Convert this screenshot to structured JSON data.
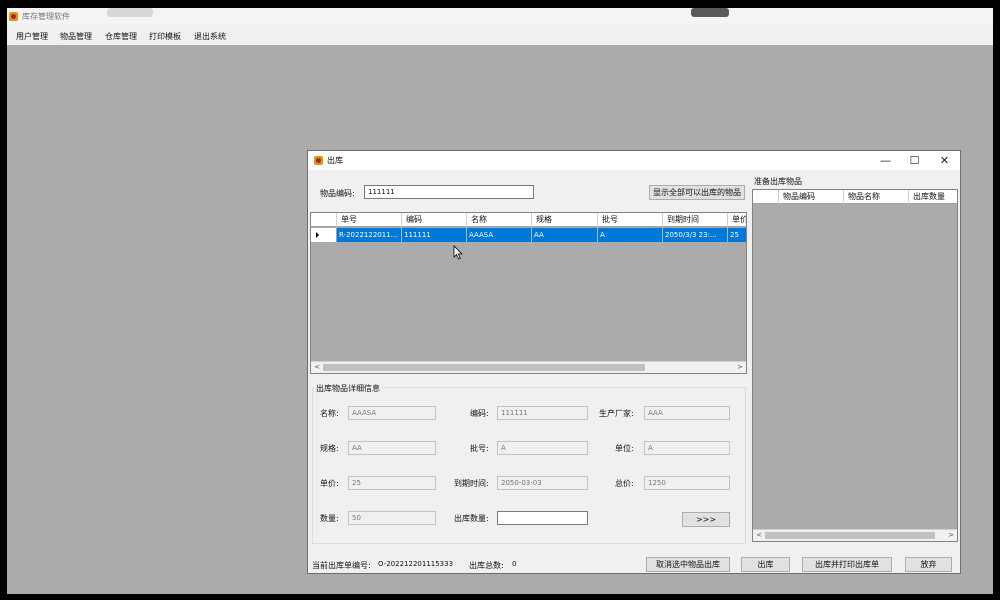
{
  "app": {
    "title": "库存管理软件"
  },
  "menu": {
    "items": [
      "用户管理",
      "物品管理",
      "仓库管理",
      "打印模板",
      "退出系统"
    ]
  },
  "dialog": {
    "title": "出库",
    "controls": {
      "minimize": "—",
      "maximize": "☐",
      "close": "✕"
    },
    "search": {
      "label": "物品编码:",
      "value": "111111"
    },
    "show_all_button": "显示全部可以出库的物品",
    "available_grid": {
      "columns": [
        "单号",
        "编码",
        "名称",
        "规格",
        "批号",
        "到期时间",
        "单价"
      ],
      "rows": [
        [
          "R-2022122011...",
          "111111",
          "AAASA",
          "AA",
          "A",
          "2050/3/3 23:...",
          "25"
        ]
      ]
    },
    "ready_title": "准备出库物品",
    "ready_grid": {
      "columns": [
        "物品编码",
        "物品名称",
        "出库数量"
      ]
    },
    "details": {
      "title": "出库物品详细信息",
      "fields": {
        "name": {
          "label": "名称:",
          "value": "AAASA"
        },
        "code": {
          "label": "编码:",
          "value": "111111"
        },
        "maker": {
          "label": "生产厂家:",
          "value": "AAA"
        },
        "spec": {
          "label": "规格:",
          "value": "AA"
        },
        "batch": {
          "label": "批号:",
          "value": "A"
        },
        "unit": {
          "label": "单位:",
          "value": "A"
        },
        "price": {
          "label": "单价:",
          "value": "25"
        },
        "expiry": {
          "label": "到期时间:",
          "value": "2050-03-03"
        },
        "total": {
          "label": "总价:",
          "value": "1250"
        },
        "qty": {
          "label": "数量:",
          "value": "50"
        },
        "out_qty": {
          "label": "出库数量:",
          "value": ""
        }
      },
      "add_button": ">>>"
    },
    "footer": {
      "order_label": "当前出库单编号:",
      "order_value": "O-202212201115333",
      "total_label": "出库总数:",
      "total_value": "0"
    },
    "buttons": {
      "cancel_selected": "取消选中物品出库",
      "out": "出库",
      "out_print": "出库并打印出库单",
      "abandon": "放弃"
    }
  },
  "scroll": {
    "left": "<",
    "right": ">"
  },
  "colors": {
    "selection": "#0078d7",
    "desktop": "#ababab",
    "window": "#f0f0f0"
  }
}
